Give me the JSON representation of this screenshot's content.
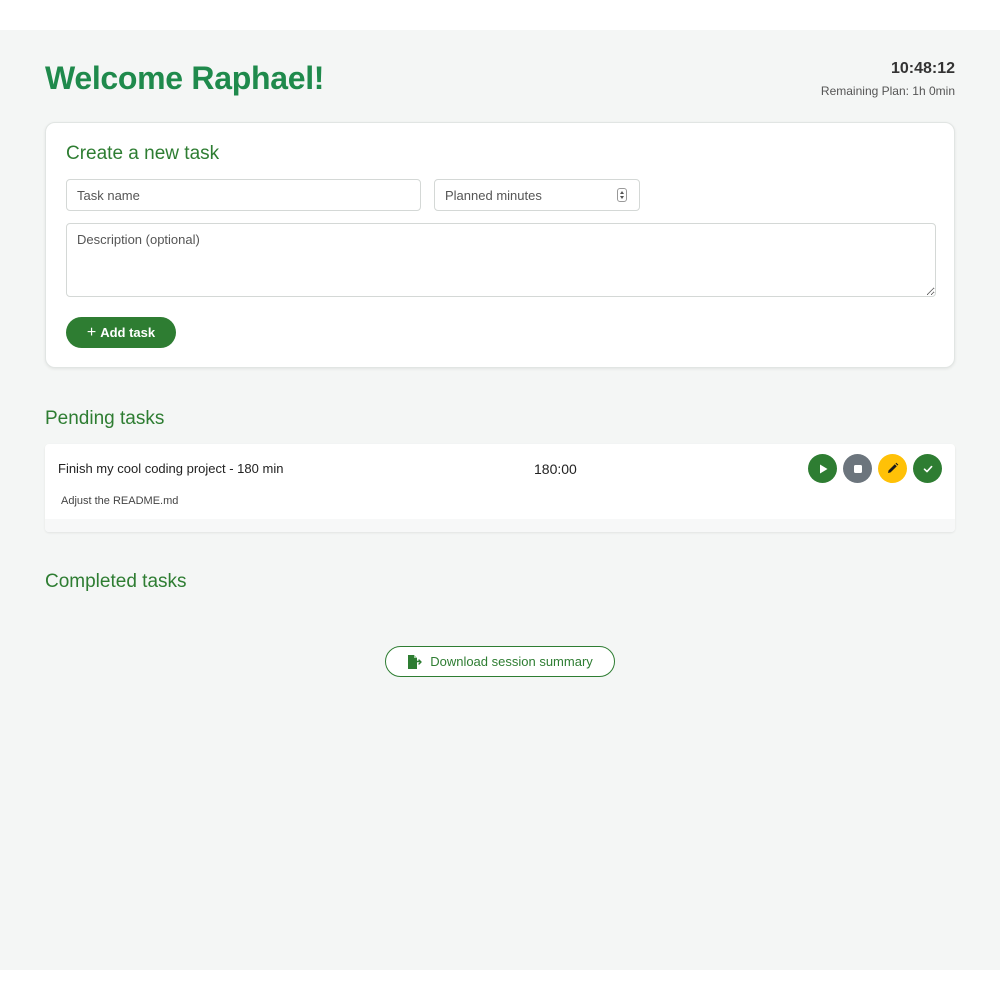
{
  "header": {
    "welcome": "Welcome Raphael!",
    "clock": "10:48:12",
    "remaining_plan": "Remaining Plan: 1h 0min"
  },
  "create_task": {
    "title": "Create a new task",
    "task_name_placeholder": "Task name",
    "task_name_value": "",
    "planned_minutes_placeholder": "Planned minutes",
    "description_placeholder": "Description (optional)",
    "description_value": "",
    "add_button_label": "Add task"
  },
  "pending": {
    "title": "Pending tasks",
    "tasks": [
      {
        "title": "Finish my cool coding project - 180 min",
        "description": "Adjust the README.md",
        "timer": "180:00",
        "actions": [
          "play-icon",
          "stop-icon",
          "pencil-icon",
          "check-icon"
        ]
      }
    ]
  },
  "completed": {
    "title": "Completed tasks",
    "tasks": []
  },
  "download_button_label": "Download session summary",
  "colors": {
    "brand_green": "#1f8a4c",
    "primary_green": "#2e7d32",
    "stop_gray": "#6c757d",
    "edit_yellow": "#ffc107",
    "page_bg": "#f4f6f5"
  }
}
